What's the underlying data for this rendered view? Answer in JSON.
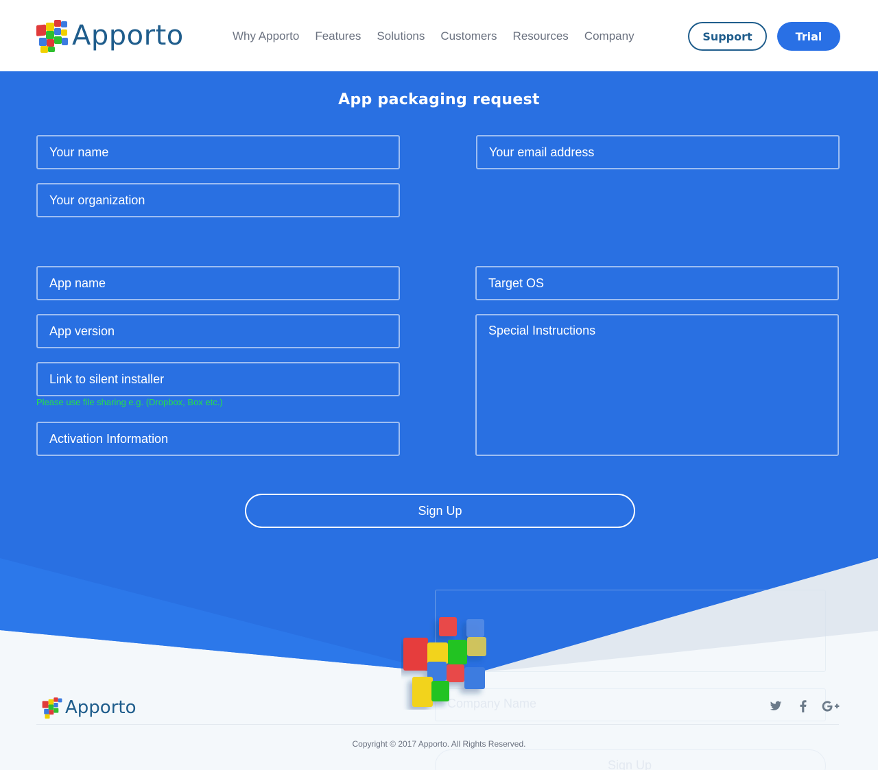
{
  "brand": {
    "name": "Apporto",
    "colors": {
      "primary_blue": "#2970e2",
      "navy": "#1f5d8c",
      "hint_green": "#25e04a"
    }
  },
  "nav": {
    "items": [
      "Why Apporto",
      "Features",
      "Solutions",
      "Customers",
      "Resources",
      "Company"
    ],
    "support_label": "Support",
    "trial_label": "Trial"
  },
  "form": {
    "title": "App packaging request",
    "fields": {
      "name": "Your name",
      "email": "Your email address",
      "organization": "Your organization",
      "app_name": "App name",
      "target_os": "Target OS",
      "app_version": "App version",
      "special_instructions": "Special Instructions",
      "installer_link": "Link to silent installer",
      "activation": "Activation Information"
    },
    "installer_hint": "Please use file sharing e.g. (Dropbox, Box etc.)",
    "submit_label": "Sign Up"
  },
  "footer": {
    "brand": "Apporto",
    "copyright": "Copyright © 2017 Apporto. All Rights Reserved.",
    "social_icons": [
      "twitter-icon",
      "facebook-icon",
      "google-plus-icon"
    ],
    "ghost_company_placeholder": "Company Name",
    "ghost_signup_label": "Sign Up"
  }
}
